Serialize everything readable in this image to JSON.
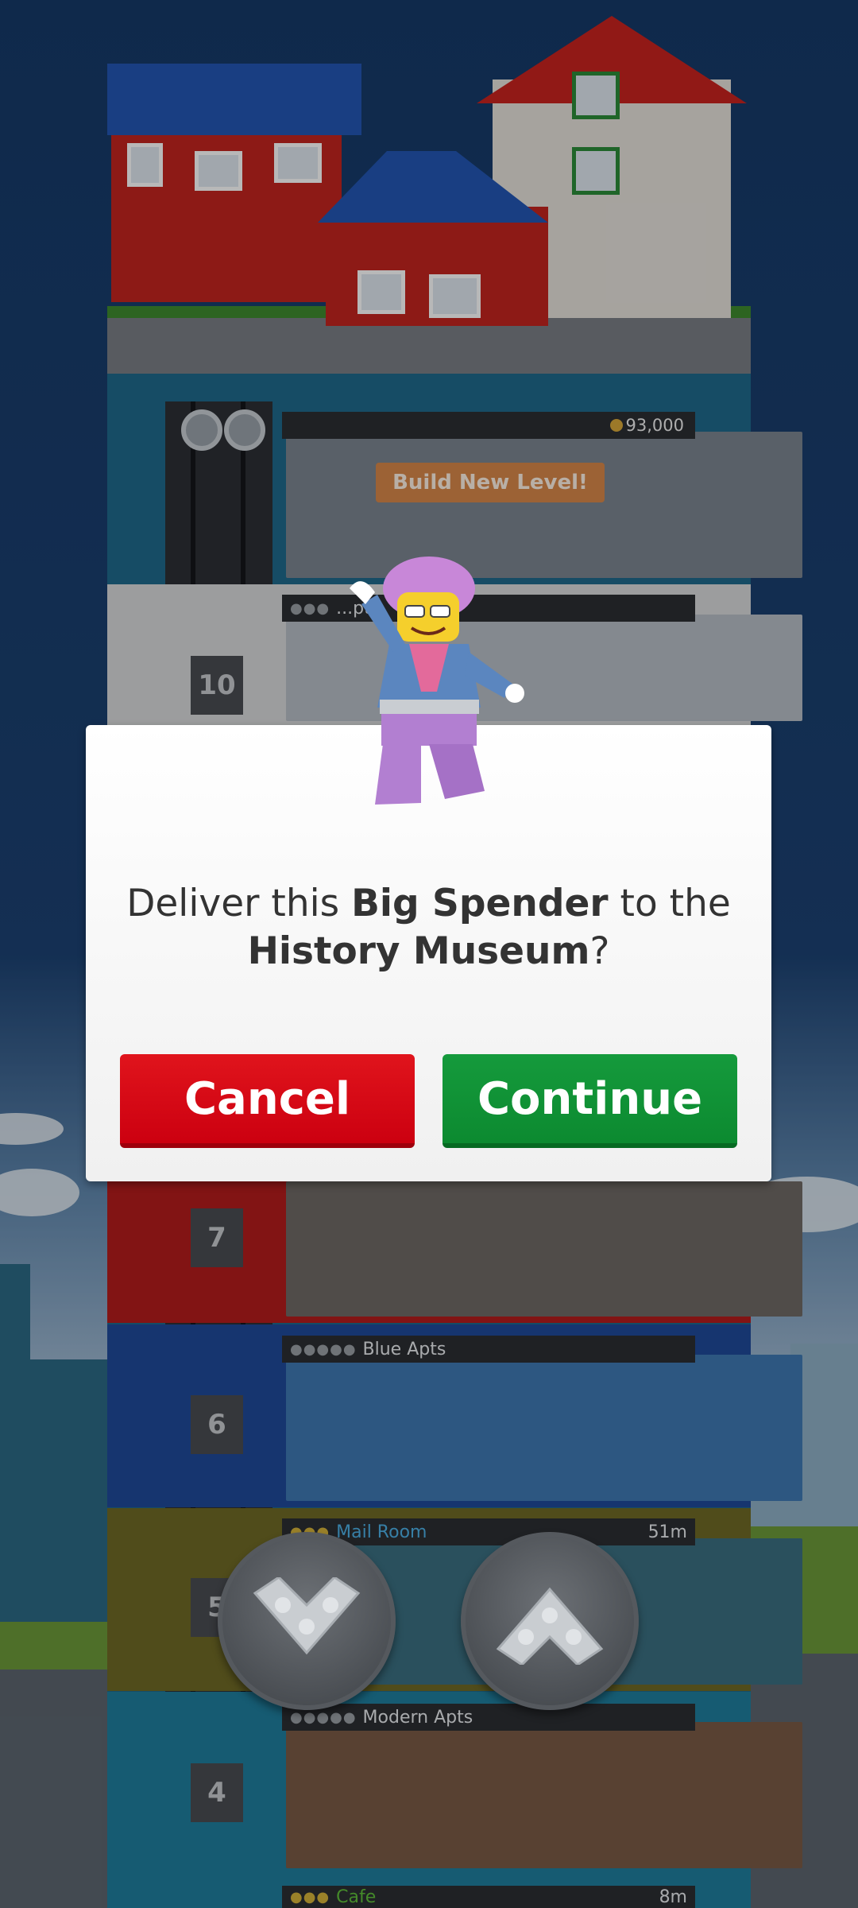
{
  "tower": {
    "coins": "93,000",
    "build_new_level": "Build New Level!",
    "floor_10": {
      "number": "10",
      "name": "...pts"
    },
    "floor_7": {
      "number": "7"
    },
    "floor_6": {
      "number": "6",
      "name": "Blue Apts",
      "stars": "●●●●●"
    },
    "floor_5": {
      "number": "5",
      "name": "Mail Room",
      "time": "51m",
      "stars": "●●●"
    },
    "floor_4": {
      "number": "4",
      "name": "Modern Apts",
      "stars": "●●●●●"
    },
    "floor_3": {
      "name": "Cafe",
      "time": "8m",
      "stars": "●●●"
    }
  },
  "dialog": {
    "text_prefix": "Deliver this ",
    "bitizen_type": "Big Spender",
    "text_middle": " to the",
    "destination": "History Museum",
    "text_suffix": "?",
    "cancel_label": "Cancel",
    "continue_label": "Continue"
  },
  "elevator_controls": {
    "down_icon": "chevron-down-icon",
    "up_icon": "chevron-up-icon"
  },
  "colors": {
    "cancel": "#d50012",
    "continue": "#0f9236",
    "sky": "#1c4273"
  }
}
